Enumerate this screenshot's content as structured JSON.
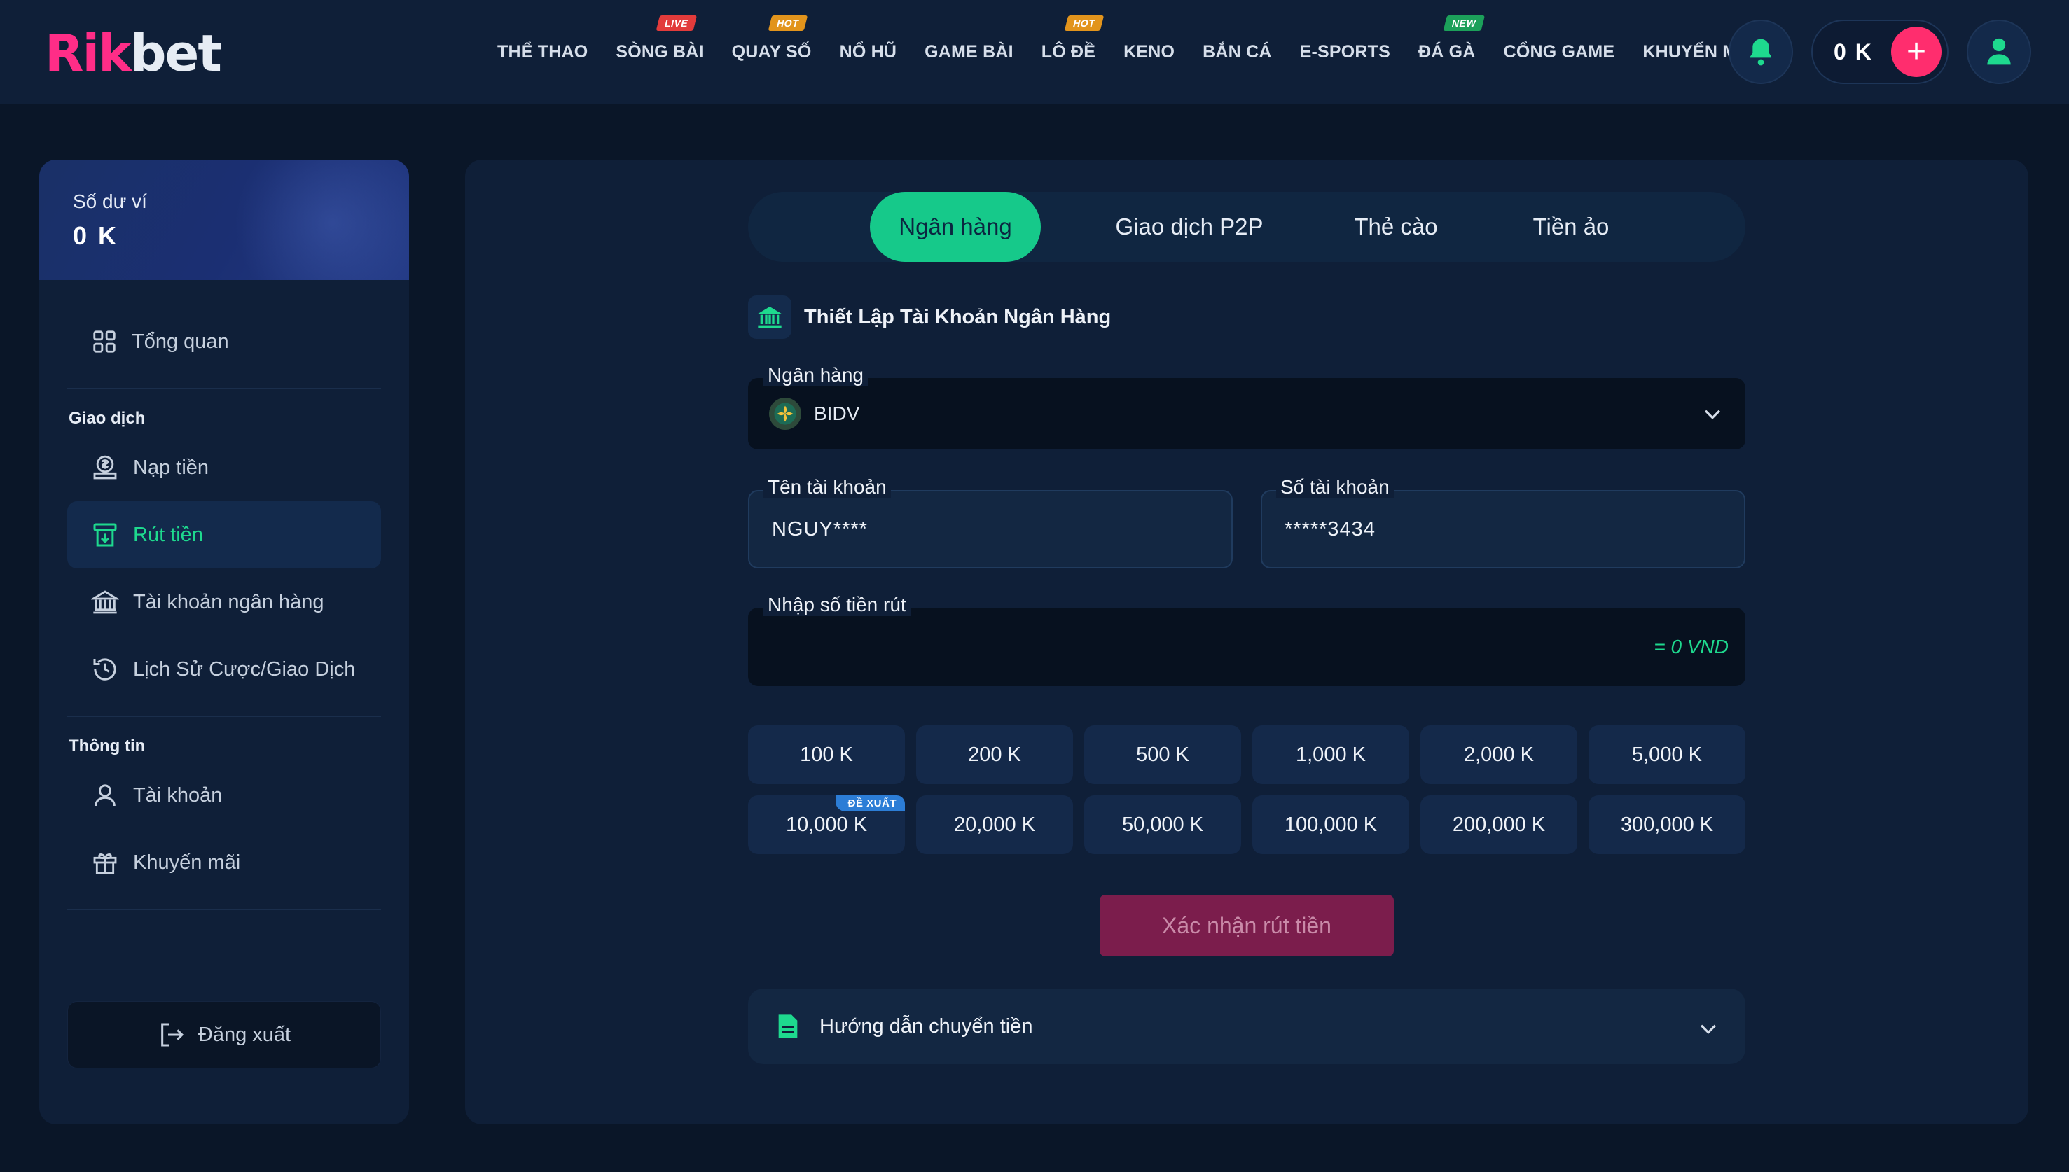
{
  "header": {
    "logo_part1": "Rik",
    "logo_part2": "bet",
    "nav": [
      {
        "label": "THỂ THAO",
        "badge": ""
      },
      {
        "label": "SÒNG BÀI",
        "badge": "LIVE"
      },
      {
        "label": "QUAY SỐ",
        "badge": "HOT"
      },
      {
        "label": "NỔ HŨ",
        "badge": ""
      },
      {
        "label": "GAME BÀI",
        "badge": ""
      },
      {
        "label": "LÔ ĐỀ",
        "badge": "HOT"
      },
      {
        "label": "KENO",
        "badge": ""
      },
      {
        "label": "BẮN CÁ",
        "badge": ""
      },
      {
        "label": "E-SPORTS",
        "badge": ""
      },
      {
        "label": "ĐÁ GÀ",
        "badge": "NEW"
      },
      {
        "label": "CỔNG GAME",
        "badge": ""
      },
      {
        "label": "KHUYẾN MÃI",
        "badge": ""
      }
    ],
    "wallet_amount": "0 K",
    "plus_label": "+"
  },
  "sidebar": {
    "balance_label": "Số dư ví",
    "balance_value": "0 K",
    "overview_label": "Tổng quan",
    "section_transactions": "Giao dịch",
    "deposit_label": "Nạp tiền",
    "withdraw_label": "Rút tiền",
    "bank_account_label": "Tài khoản ngân hàng",
    "history_label": "Lịch Sử Cược/Giao Dịch",
    "section_info": "Thông tin",
    "account_label": "Tài khoản",
    "promo_label": "Khuyến mãi",
    "logout_label": "Đăng xuất"
  },
  "main": {
    "tabs": [
      "Ngân hàng",
      "Giao dịch P2P",
      "Thẻ cào",
      "Tiền ảo"
    ],
    "section_title": "Thiết Lập Tài Khoản Ngân Hàng",
    "bank_label": "Ngân hàng",
    "bank_value": "BIDV",
    "account_name_label": "Tên tài khoản",
    "account_name_value": "NGUY****",
    "account_number_label": "Số tài khoản",
    "account_number_value": "*****3434",
    "amount_label": "Nhập số tiền rút",
    "amount_equivalent": "= 0 VND",
    "chips": [
      "100 K",
      "200 K",
      "500 K",
      "1,000 K",
      "2,000 K",
      "5,000 K",
      "10,000 K",
      "20,000 K",
      "50,000 K",
      "100,000 K",
      "200,000 K",
      "300,000 K"
    ],
    "recommended_tag": "ĐỀ XUẤT",
    "confirm_label": "Xác nhận rút tiền",
    "guide_label": "Hướng dẫn chuyển tiền"
  },
  "colors": {
    "accent_green": "#16c98a",
    "accent_pink": "#ff2d6e",
    "confirm_disabled": "#7b1d4c",
    "panel": "#0f1f38",
    "page_bg": "#0a1628"
  }
}
